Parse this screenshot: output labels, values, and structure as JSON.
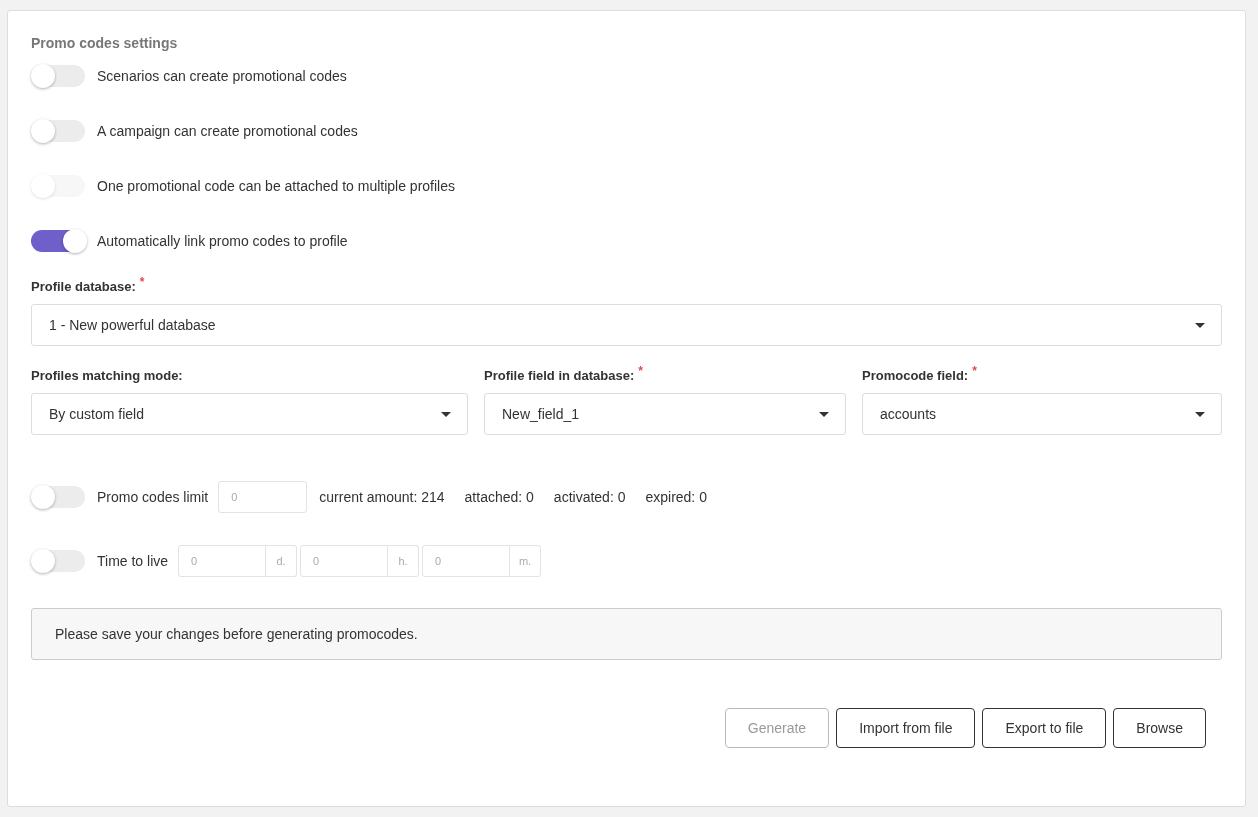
{
  "title": "Promo codes settings",
  "toggles": [
    {
      "label": "Scenarios can create promotional codes",
      "on": false,
      "disabled": false
    },
    {
      "label": "A campaign can create promotional codes",
      "on": false,
      "disabled": false
    },
    {
      "label": "One promotional code can be attached to multiple profiles",
      "on": false,
      "disabled": true
    },
    {
      "label": "Automatically link promo codes to profile",
      "on": true,
      "disabled": false
    }
  ],
  "profile_database": {
    "label": "Profile database:",
    "required_mark": "*",
    "value": "1 - New powerful database"
  },
  "selects": [
    {
      "label": "Profiles matching mode:",
      "value": "By custom field"
    },
    {
      "label": "Profile field in database:",
      "required_mark": "*",
      "value": "New_field_1"
    },
    {
      "label": "Promocode field:",
      "required_mark": "*",
      "value": "accounts"
    }
  ],
  "limit": {
    "on": false,
    "label": "Promo codes limit",
    "placeholder": "0",
    "stats": [
      "current amount: 214",
      "attached: 0",
      "activated: 0",
      "expired: 0"
    ]
  },
  "ttl": {
    "on": false,
    "label": "Time to live",
    "fields": [
      {
        "placeholder": "0",
        "unit": "d."
      },
      {
        "placeholder": "0",
        "unit": "h."
      },
      {
        "placeholder": "0",
        "unit": "m."
      }
    ]
  },
  "notice": "Please save your changes before generating promocodes.",
  "buttons": [
    {
      "label": "Generate",
      "disabled": true
    },
    {
      "label": "Import from file",
      "disabled": false
    },
    {
      "label": "Export to file",
      "disabled": false
    },
    {
      "label": "Browse",
      "disabled": false
    }
  ]
}
